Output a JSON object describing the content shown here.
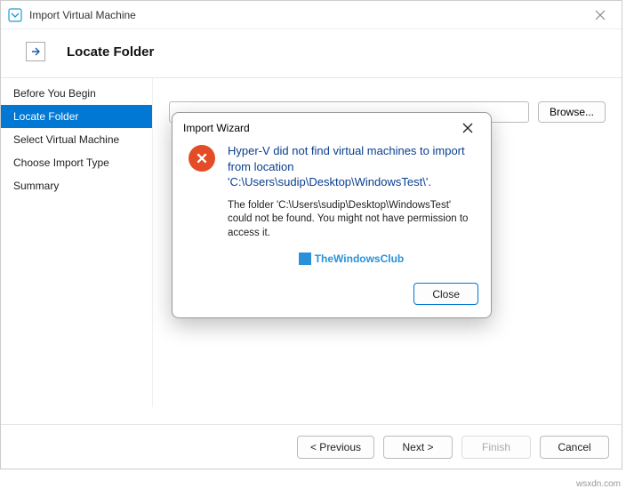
{
  "window": {
    "title": "Import Virtual Machine"
  },
  "header": {
    "title": "Locate Folder"
  },
  "sidebar": {
    "items": [
      {
        "label": "Before You Begin"
      },
      {
        "label": "Locate Folder"
      },
      {
        "label": "Select Virtual Machine"
      },
      {
        "label": "Choose Import Type"
      },
      {
        "label": "Summary"
      }
    ]
  },
  "main": {
    "browse_label": "Browse..."
  },
  "footer": {
    "previous": "< Previous",
    "next": "Next >",
    "finish": "Finish",
    "cancel": "Cancel"
  },
  "dialog": {
    "title": "Import Wizard",
    "headline": "Hyper-V did not find virtual machines to import from location 'C:\\Users\\sudip\\Desktop\\WindowsTest\\'.",
    "detail": "The folder 'C:\\Users\\sudip\\Desktop\\WindowsTest' could not be found. You might not have permission to access it.",
    "close": "Close"
  },
  "watermark": "TheWindowsClub",
  "corner": "wsxdn.com"
}
